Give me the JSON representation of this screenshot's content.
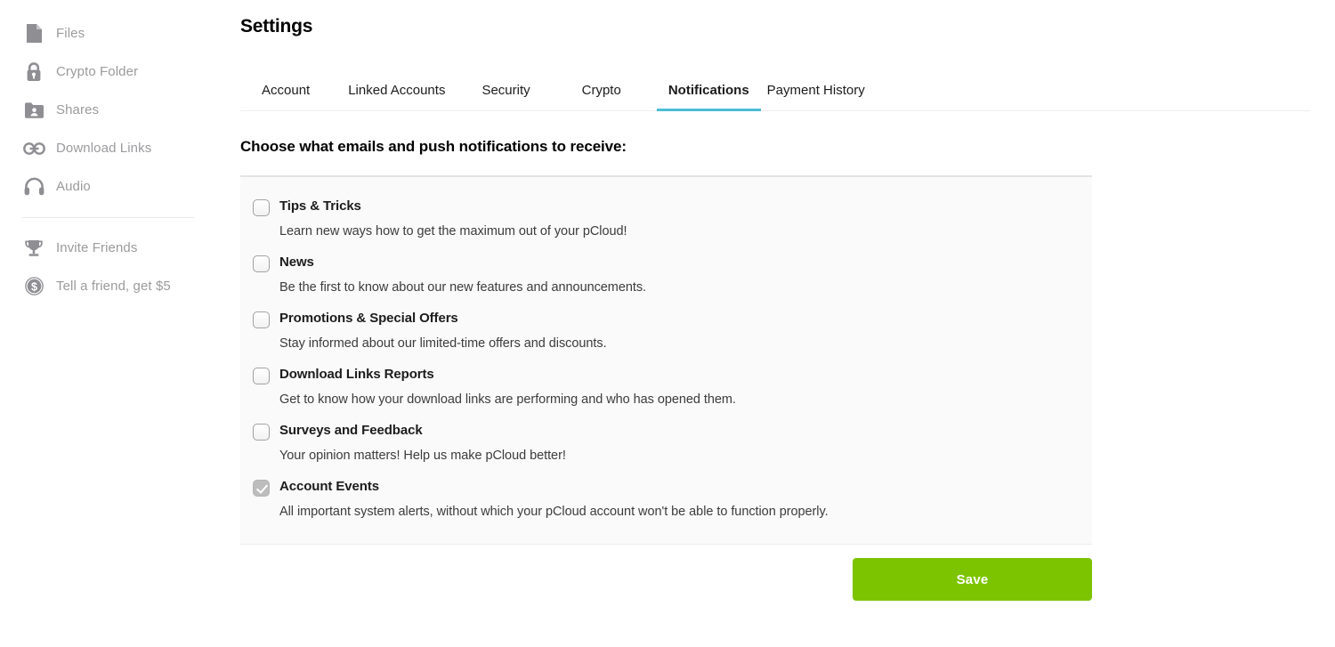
{
  "sidebar": {
    "items": [
      {
        "label": "Files",
        "icon": "file-icon"
      },
      {
        "label": "Crypto Folder",
        "icon": "lock-icon"
      },
      {
        "label": "Shares",
        "icon": "shared-folder-icon"
      },
      {
        "label": "Download Links",
        "icon": "link-icon"
      },
      {
        "label": "Audio",
        "icon": "headphones-icon"
      }
    ],
    "footer_items": [
      {
        "label": "Invite Friends",
        "icon": "trophy-icon"
      },
      {
        "label": "Tell a friend, get $5",
        "icon": "dollar-coin-icon"
      }
    ]
  },
  "header": {
    "title": "Settings"
  },
  "tabs": [
    {
      "label": "Account",
      "active": false
    },
    {
      "label": "Linked Accounts",
      "active": false
    },
    {
      "label": "Security",
      "active": false
    },
    {
      "label": "Crypto",
      "active": false
    },
    {
      "label": "Notifications",
      "active": true
    },
    {
      "label": "Payment History",
      "active": false
    }
  ],
  "main": {
    "section_heading": "Choose what emails and push notifications to receive:",
    "notifications": [
      {
        "title": "Tips & Tricks",
        "description": "Learn new ways how to get the maximum out of your pCloud!",
        "checked": false
      },
      {
        "title": "News",
        "description": "Be the first to know about our new features and announcements.",
        "checked": false
      },
      {
        "title": "Promotions & Special Offers",
        "description": "Stay informed about our limited-time offers and discounts.",
        "checked": false
      },
      {
        "title": "Download Links Reports",
        "description": "Get to know how your download links are performing and who has opened them.",
        "checked": false
      },
      {
        "title": "Surveys and Feedback",
        "description": "Your opinion matters! Help us make pCloud better!",
        "checked": false
      },
      {
        "title": "Account Events",
        "description": "All important system alerts, without which your pCloud account won't be able to function properly.",
        "checked": true
      }
    ],
    "save_label": "Save"
  },
  "colors": {
    "accent_teal": "#4bbdd7",
    "save_green": "#7dc400",
    "sidebar_text": "#9b9b9e",
    "panel_bg": "#fafafa"
  }
}
